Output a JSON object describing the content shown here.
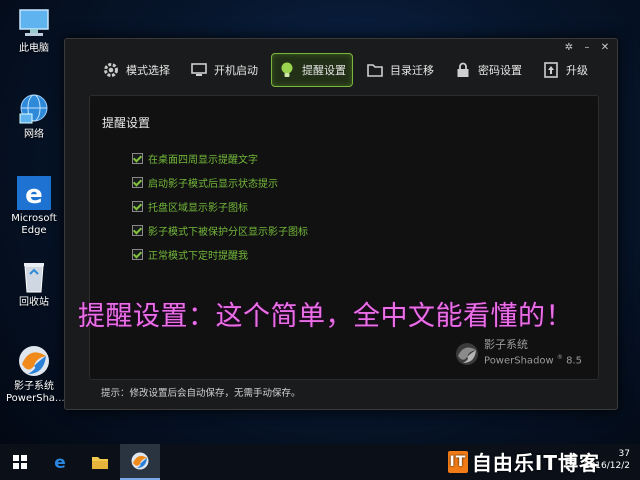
{
  "desktop": {
    "icons": [
      {
        "label": "此电脑"
      },
      {
        "label": "网络"
      },
      {
        "label": "Microsoft Edge"
      },
      {
        "label": "回收站"
      },
      {
        "label": "影子系统 PowerSha..."
      }
    ]
  },
  "window": {
    "controls": {
      "settings": "✲",
      "minimize": "–",
      "close": "✕"
    },
    "tabs": [
      {
        "label": "模式选择",
        "icon": "gear-icon"
      },
      {
        "label": "开机启动",
        "icon": "monitor-icon"
      },
      {
        "label": "提醒设置",
        "icon": "lightbulb-icon",
        "active": true
      },
      {
        "label": "目录迁移",
        "icon": "folder-icon"
      },
      {
        "label": "密码设置",
        "icon": "lock-icon"
      },
      {
        "label": "升级",
        "icon": "upgrade-icon"
      }
    ],
    "panel": {
      "title": "提醒设置",
      "options": [
        {
          "label": "在桌面四周显示提醒文字",
          "checked": true
        },
        {
          "label": "启动影子模式后显示状态提示",
          "checked": true
        },
        {
          "label": "托盘区域显示影子图标",
          "checked": true
        },
        {
          "label": "影子模式下被保护分区显示影子图标",
          "checked": true
        },
        {
          "label": "正常模式下定时提醒我",
          "checked": true
        }
      ],
      "brand": {
        "name": "影子系统",
        "product": "PowerShadow",
        "version": "8.5"
      }
    },
    "status": "提示：修改设置后会自动保存，无需手动保存。"
  },
  "overlay_caption": "提醒设置：这个简单，全中文能看懂的！",
  "taskbar": {
    "clock_time": "37",
    "clock_date": "2016/12/2",
    "watermark_badge": "IT",
    "watermark_text": "自由乐IT博客"
  },
  "colors": {
    "accent_green": "#79b83a",
    "option_text": "#73b83a",
    "overlay": "#ea6ee6"
  }
}
